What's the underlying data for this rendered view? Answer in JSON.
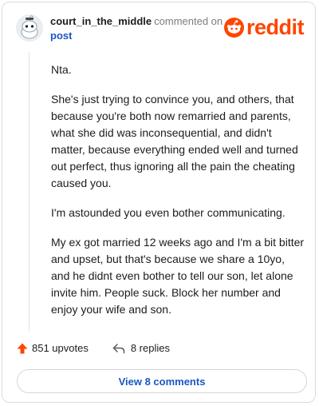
{
  "comment": {
    "username": "court_in_the_middle",
    "action_text": "commented on",
    "post_link": "post",
    "paragraphs": [
      "Nta.",
      "She's just trying to convince you, and others, that because you're both now remarried and parents, what she did was inconsequential, and didn't matter, because everything ended well and turned out perfect, thus ignoring all the pain the cheating caused you.",
      "I'm astounded you even bother communicating.",
      "My ex got married 12 weeks ago and I'm a bit bitter and upset, but that's because we share a 10yo, and he didnt even bother to tell our son, let alone invite him. People suck. Block her number and enjoy your wife and son."
    ]
  },
  "brand": {
    "wordmark": "reddit",
    "color": "#ff4500"
  },
  "footer": {
    "upvotes": "851 upvotes",
    "replies": "8 replies",
    "upvote_icon": "upvote-arrow-icon",
    "reply_icon": "reply-arrow-icon"
  },
  "view_comments_label": "View 8 comments",
  "colors": {
    "link": "#1a56c4",
    "upvote": "#ff4500",
    "text": "#1c1c1c",
    "muted": "#7c7c7c"
  }
}
